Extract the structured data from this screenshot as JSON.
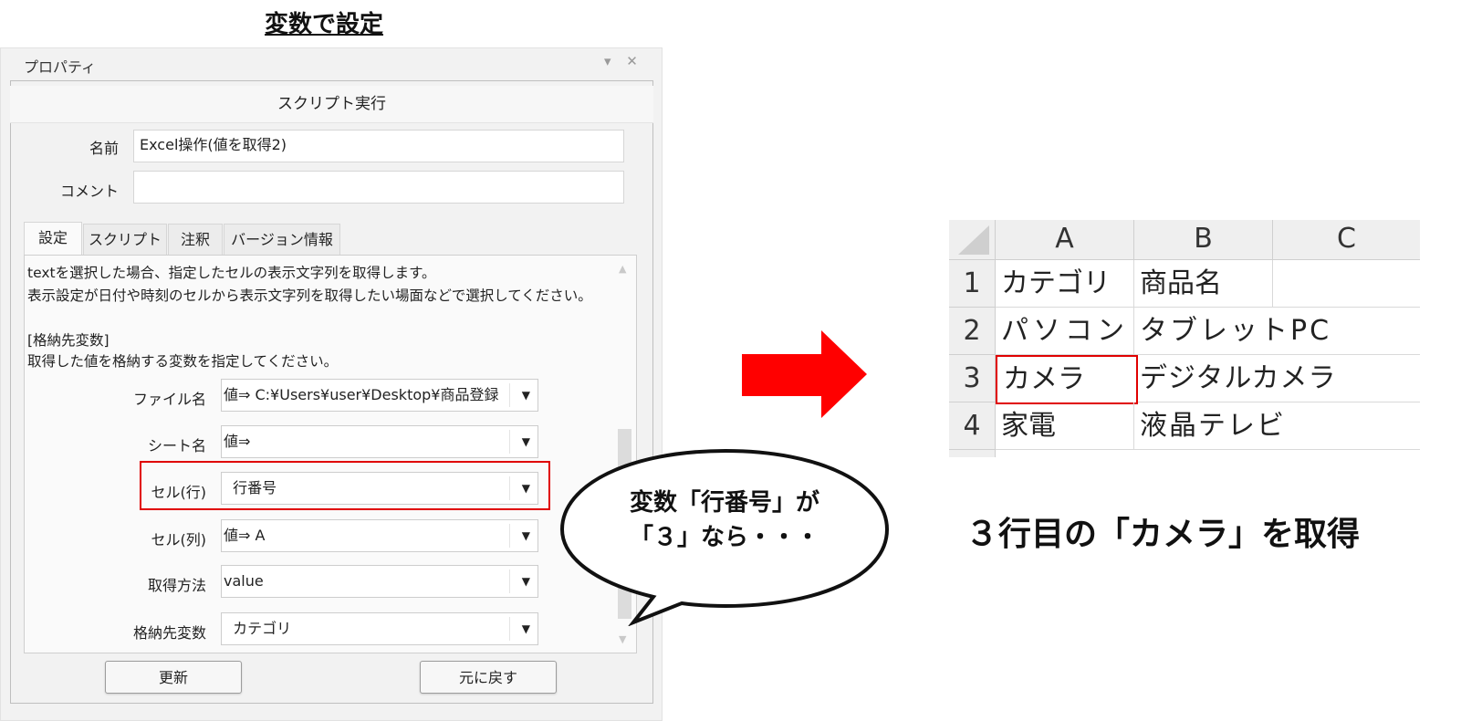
{
  "heading": "変数で設定",
  "panel": {
    "title": "プロパティ",
    "controls": "▾ ✕",
    "section_title": "スクリプト実行",
    "name_label": "名前",
    "name_value": "Excel操作(値を取得2)",
    "comment_label": "コメント",
    "comment_value": "",
    "tabs": [
      "設定",
      "スクリプト",
      "注釈",
      "バージョン情報"
    ],
    "description": [
      "textを選択した場合、指定したセルの表示文字列を取得します。",
      "表示設定が日付や時刻のセルから表示文字列を取得したい場面などで選択してください。",
      "",
      "[格納先変数]",
      "取得した値を格納する変数を指定してください。"
    ],
    "params": [
      {
        "label": "ファイル名",
        "value": "値⇒  C:¥Users¥user¥Desktop¥商品登録"
      },
      {
        "label": "シート名",
        "value": "値⇒"
      },
      {
        "label": "セル(行)",
        "value": "  行番号"
      },
      {
        "label": "セル(列)",
        "value": "値⇒  A"
      },
      {
        "label": "取得方法",
        "value": "value"
      },
      {
        "label": "格納先変数",
        "value": "  カテゴリ"
      }
    ],
    "update_button": "更新",
    "revert_button": "元に戻す"
  },
  "callout": {
    "line1": "変数「行番号」が",
    "line2": "「３」なら・・・"
  },
  "sheet": {
    "columns": [
      "A",
      "B",
      "C"
    ],
    "rows": [
      {
        "num": "1",
        "cells": [
          "カテゴリ",
          "商品名",
          ""
        ]
      },
      {
        "num": "2",
        "cells": [
          "パソコン",
          "タブレットPC",
          ""
        ]
      },
      {
        "num": "3",
        "cells": [
          "カメラ",
          "デジタルカメラ",
          ""
        ]
      },
      {
        "num": "4",
        "cells": [
          "家電",
          "液晶テレビ",
          ""
        ]
      }
    ]
  },
  "result": "３行目の「カメラ」を取得",
  "colors": {
    "highlight": "#e00000",
    "arrow": "#ff0000"
  }
}
